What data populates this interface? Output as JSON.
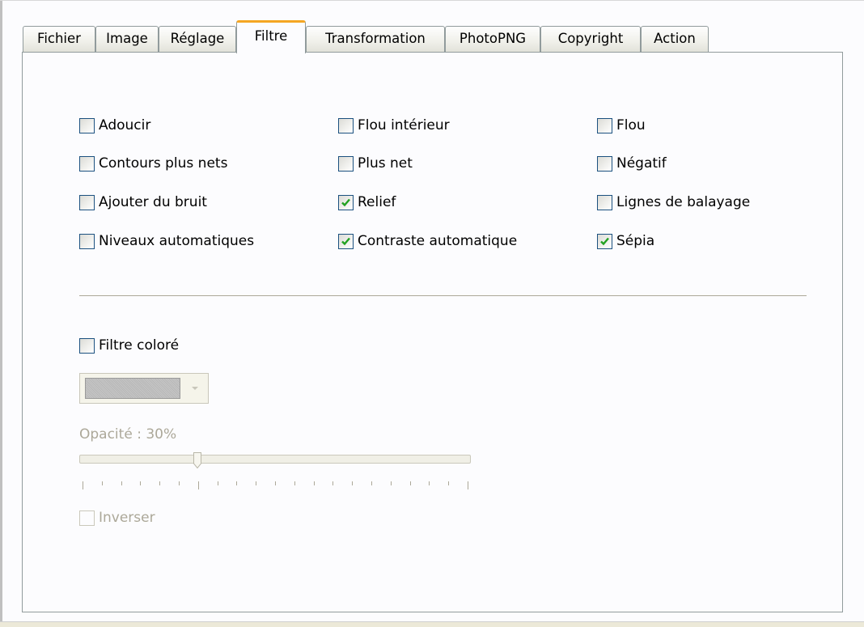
{
  "tabs": [
    {
      "label": "Fichier",
      "active": false
    },
    {
      "label": "Image",
      "active": false
    },
    {
      "label": "Réglage",
      "active": false
    },
    {
      "label": "Filtre",
      "active": true
    },
    {
      "label": "Transformation",
      "active": false
    },
    {
      "label": "PhotoPNG",
      "active": false
    },
    {
      "label": "Copyright",
      "active": false
    },
    {
      "label": "Action",
      "active": false
    }
  ],
  "filters": [
    {
      "label": "Adoucir",
      "checked": false
    },
    {
      "label": "Flou intérieur",
      "checked": false
    },
    {
      "label": "Flou",
      "checked": false
    },
    {
      "label": "Contours plus nets",
      "checked": false
    },
    {
      "label": "Plus net",
      "checked": false
    },
    {
      "label": "Négatif",
      "checked": false
    },
    {
      "label": "Ajouter du bruit",
      "checked": false
    },
    {
      "label": "Relief",
      "checked": true
    },
    {
      "label": "Lignes de balayage",
      "checked": false
    },
    {
      "label": "Niveaux automatiques",
      "checked": false
    },
    {
      "label": "Contraste automatique",
      "checked": true
    },
    {
      "label": "Sépia",
      "checked": true
    }
  ],
  "color_filter": {
    "label": "Filtre coloré",
    "checked": false,
    "swatch_color": "#c0c0c0"
  },
  "opacity": {
    "label": "Opacité : 30%",
    "value_percent": 30,
    "enabled": false
  },
  "invert": {
    "label": "Inverser",
    "checked": false,
    "enabled": false
  },
  "colors": {
    "check_mark": "#21a121",
    "active_tab_accent": "#f5a623",
    "disabled_text": "#aca899"
  }
}
